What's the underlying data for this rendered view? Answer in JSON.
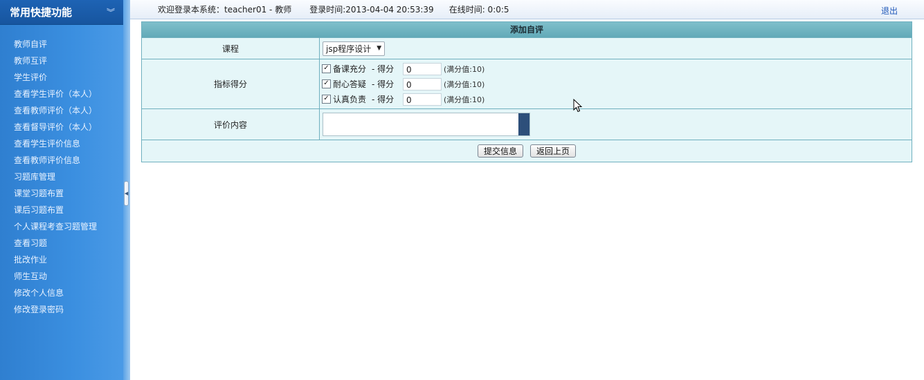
{
  "sidebar": {
    "title": "常用快捷功能",
    "items": [
      {
        "label": "教师自评"
      },
      {
        "label": "教师互评"
      },
      {
        "label": "学生评价"
      },
      {
        "label": "查看学生评价（本人）"
      },
      {
        "label": "查看教师评价（本人）"
      },
      {
        "label": "查看督导评价（本人）"
      },
      {
        "label": "查看学生评价信息"
      },
      {
        "label": "查看教师评价信息"
      },
      {
        "label": "习题库管理"
      },
      {
        "label": "课堂习题布置"
      },
      {
        "label": "课后习题布置"
      },
      {
        "label": "个人课程考查习题管理"
      },
      {
        "label": "查看习题"
      },
      {
        "label": "批改作业"
      },
      {
        "label": "师生互动"
      },
      {
        "label": "修改个人信息"
      },
      {
        "label": "修改登录密码"
      }
    ]
  },
  "topbar": {
    "welcome": "欢迎登录本系统：teacher01 - 教师",
    "login_time": "登录时间:2013-04-04 20:53:39",
    "online_time": "在线时间: 0:0:5",
    "logout": "退出"
  },
  "form": {
    "title": "添加自评",
    "course_label": "课程",
    "course_value": "jsp程序设计",
    "score_label": "指标得分",
    "indicators": [
      {
        "name": "备课充分",
        "checked": true,
        "sep": "- 得分",
        "score": "0",
        "full": "(满分值:10)"
      },
      {
        "name": "耐心答疑",
        "checked": true,
        "sep": "- 得分",
        "score": "0",
        "full": "(满分值:10)"
      },
      {
        "name": "认真负责",
        "checked": true,
        "sep": "- 得分",
        "score": "0",
        "full": "(满分值:10)"
      }
    ],
    "content_label": "评价内容",
    "content_value": "",
    "submit_label": "提交信息",
    "back_label": "返回上页"
  }
}
